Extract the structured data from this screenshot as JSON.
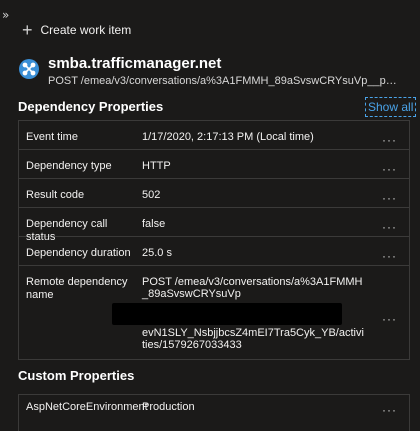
{
  "toolbar": {
    "collapse_glyph": "»",
    "create_label": "Create work item"
  },
  "header": {
    "title": "smba.trafficmanager.net",
    "subtitle": "POST /emea/v3/conversations/a%3A1FMMH_89aSvswCRYsuVp__pTzAMGkYmg2w..."
  },
  "dependency": {
    "section_title": "Dependency Properties",
    "show_all": "Show all",
    "rows": [
      {
        "name": "Event time",
        "value": "1/17/2020, 2:17:13 PM (Local time)"
      },
      {
        "name": "Dependency type",
        "value": "HTTP"
      },
      {
        "name": "Result code",
        "value": "502"
      },
      {
        "name": "Dependency call status",
        "value": "false"
      },
      {
        "name": "Dependency duration",
        "value": "25.0 s"
      },
      {
        "name": "Remote dependency name",
        "value_start": "POST /emea/v3/conversations/a%3A1FMMH_89aSvswCRYsuVp",
        "value_end": "evN1SLY_NsbjjbcsZ4mEI7Tra5Cyk_YB/activities/1579267033433"
      }
    ]
  },
  "custom": {
    "section_title": "Custom Properties",
    "rows": [
      {
        "name": "AspNetCoreEnvironment",
        "value": "Production"
      }
    ]
  },
  "menu_glyph": "···",
  "colors": {
    "background": "#1b1a19",
    "accent": "#4aa3e8",
    "border": "#3b3a39"
  }
}
